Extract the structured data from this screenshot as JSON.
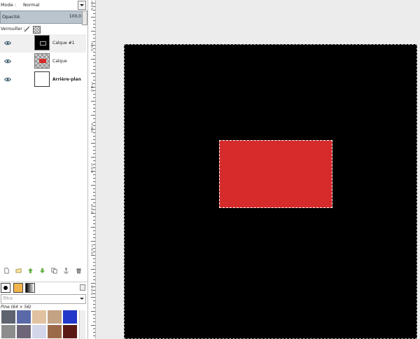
{
  "mode": {
    "label": "Mode :",
    "value": "Normal"
  },
  "opacity": {
    "label": "Opacité",
    "value": "100,0"
  },
  "lock": {
    "label": "Verrouiller :"
  },
  "layers": [
    {
      "name": "Calque #1",
      "thumb": "black",
      "bold": false,
      "selected": true
    },
    {
      "name": "Calque",
      "thumb": "checker",
      "bold": false,
      "selected": false
    },
    {
      "name": "Arrière-plan",
      "thumb": "white",
      "bold": true,
      "selected": false
    }
  ],
  "layer_tools": [
    "new-layer-icon",
    "new-group-icon",
    "raise-layer-icon",
    "lower-layer-icon",
    "duplicate-layer-icon",
    "anchor-layer-icon",
    "delete-layer-icon"
  ],
  "filter": {
    "placeholder": "filtre"
  },
  "pattern": {
    "name": "Pine (64 × 56)"
  },
  "pattern_swatches": [
    "#5e6470",
    "#5a69a8",
    "#e0c2a0",
    "#c4a284",
    "#2238c8",
    "#8c8c8c",
    "#6e6678",
    "#d2d6e8",
    "#9c6a4a",
    "#5a1a14"
  ],
  "ruler": {
    "labels": [
      "1\n0\n0",
      "2\n0\n0",
      "3\n0\n0",
      "4\n0\n0",
      "5\n0\n0",
      "6\n0\n0",
      "7\n0\n0",
      "8\n0\n0"
    ]
  },
  "colors": {
    "canvas": "#000000",
    "selection": "#d62b2b",
    "panel": "#ffffff"
  }
}
